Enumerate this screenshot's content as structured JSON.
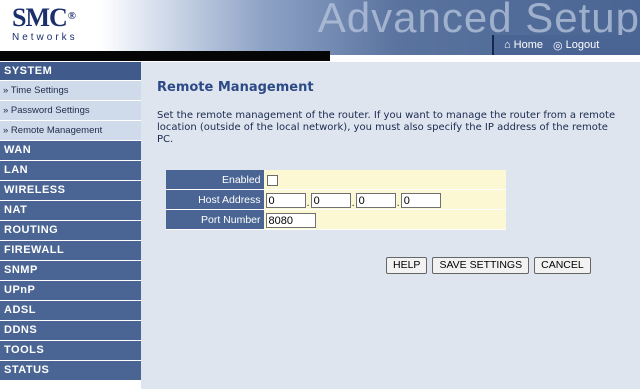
{
  "header": {
    "logo": "SMC",
    "logo_mark": "®",
    "logo_sub": "Networks",
    "banner_title": "Advanced Setup",
    "home_label": "Home",
    "logout_label": "Logout",
    "home_icon": "home-icon",
    "logout_icon": "logout-icon"
  },
  "sidebar": {
    "section": "SYSTEM",
    "subitems": [
      "» Time Settings",
      "» Password Settings",
      "» Remote Management"
    ],
    "items": [
      "WAN",
      "LAN",
      "WIRELESS",
      "NAT",
      "ROUTING",
      "FIREWALL",
      "SNMP",
      "UPnP",
      "ADSL",
      "DDNS",
      "TOOLS",
      "STATUS"
    ]
  },
  "main": {
    "title": "Remote Management",
    "description": "Set the remote management of the router. If you want to manage the router from a remote location (outside of the local network), you must also specify the IP address of the remote PC.",
    "form": {
      "enabled_label": "Enabled",
      "enabled_checked": false,
      "host_label": "Host Address",
      "host_octets": [
        "0",
        "0",
        "0",
        "0"
      ],
      "port_label": "Port Number",
      "port_value": "8080"
    },
    "buttons": {
      "help": "HELP",
      "save": "SAVE SETTINGS",
      "cancel": "CANCEL"
    }
  },
  "colors": {
    "nav_blue": "#4a6593",
    "nav_light": "#cfdaea",
    "title_blue": "#2c4a86",
    "form_yellow": "#fbf8d3",
    "content_bg": "#dfe5ef"
  }
}
